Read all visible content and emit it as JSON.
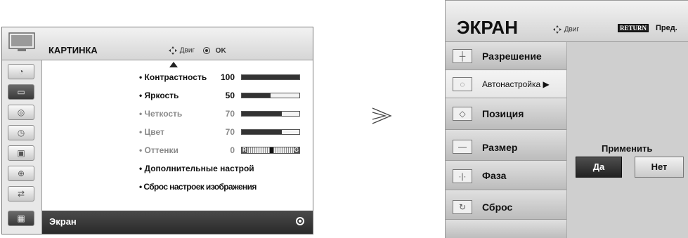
{
  "left_menu": {
    "title": "КАРТИНКА",
    "move_hint": "Двиг",
    "ok_hint": "OK",
    "rows": [
      {
        "label": "• Контрастность",
        "value": "100",
        "level": 1.0
      },
      {
        "label": "• Яркость",
        "value": "50",
        "level": 0.5
      },
      {
        "label": "• Четкость",
        "value": "70",
        "level": 0.7
      },
      {
        "label": "• Цвет",
        "value": "70",
        "level": 0.7
      },
      {
        "label": "• Оттенки",
        "value": "0",
        "tint_left": "R",
        "tint_right": "G"
      },
      {
        "label": "• Дополнительные настрой"
      },
      {
        "label": "• Сброс настроек изображения"
      }
    ],
    "footer_label": "Экран"
  },
  "right_panel": {
    "title": "ЭКРАН",
    "move_hint": "Двиг",
    "return_badge": "RETURN",
    "prev_label": "Пред.",
    "items": [
      {
        "label": "Разрешение",
        "icon": "crosshair-icon"
      },
      {
        "label": "Автонастройка ▶",
        "icon": "auto-config-icon"
      },
      {
        "label": "Позиция",
        "icon": "position-icon"
      },
      {
        "label": "Размер",
        "icon": "size-icon"
      },
      {
        "label": "Фаза",
        "icon": "phase-icon"
      },
      {
        "label": "Сброс",
        "icon": "reset-icon"
      }
    ],
    "apply_label": "Применить",
    "yes_label": "Да",
    "no_label": "Нет"
  }
}
